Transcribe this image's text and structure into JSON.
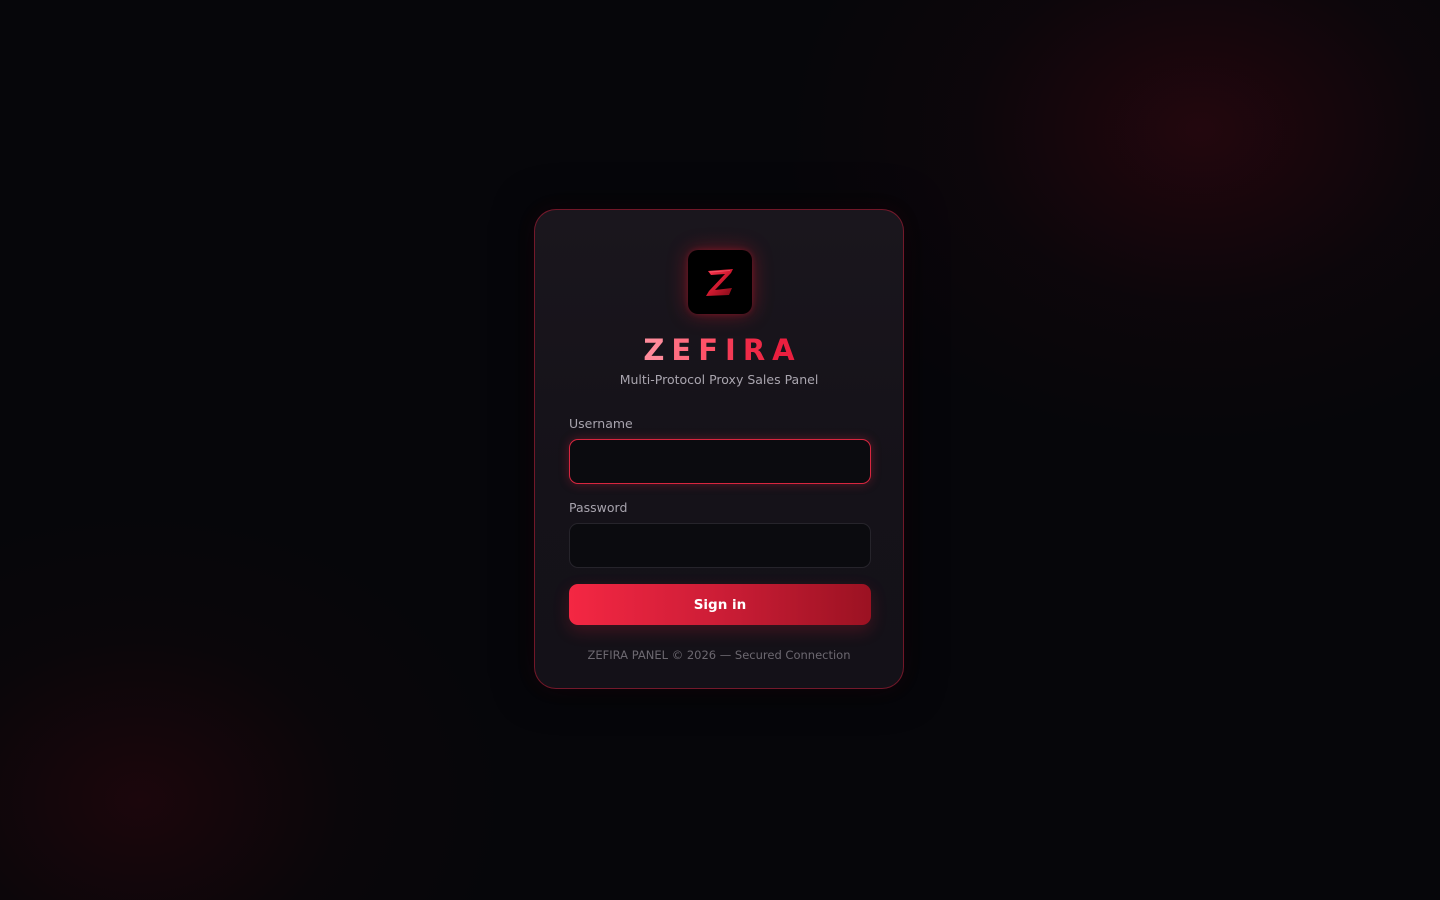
{
  "brand": {
    "logo_icon": "z-logo-icon",
    "logo_letter": "Z",
    "name_letters": [
      "Z",
      "E",
      "F",
      "I",
      "R",
      "A"
    ],
    "subtitle": "Multi-Protocol Proxy Sales Panel"
  },
  "form": {
    "username": {
      "label": "Username",
      "value": "",
      "placeholder": ""
    },
    "password": {
      "label": "Password",
      "value": "",
      "placeholder": ""
    },
    "submit_label": "Sign in"
  },
  "footer": {
    "text": "ZEFIRA PANEL © 2026 — Secured Connection"
  },
  "colors": {
    "accent": "#ea1f3f",
    "background": "#06060a",
    "card": "#151219"
  }
}
